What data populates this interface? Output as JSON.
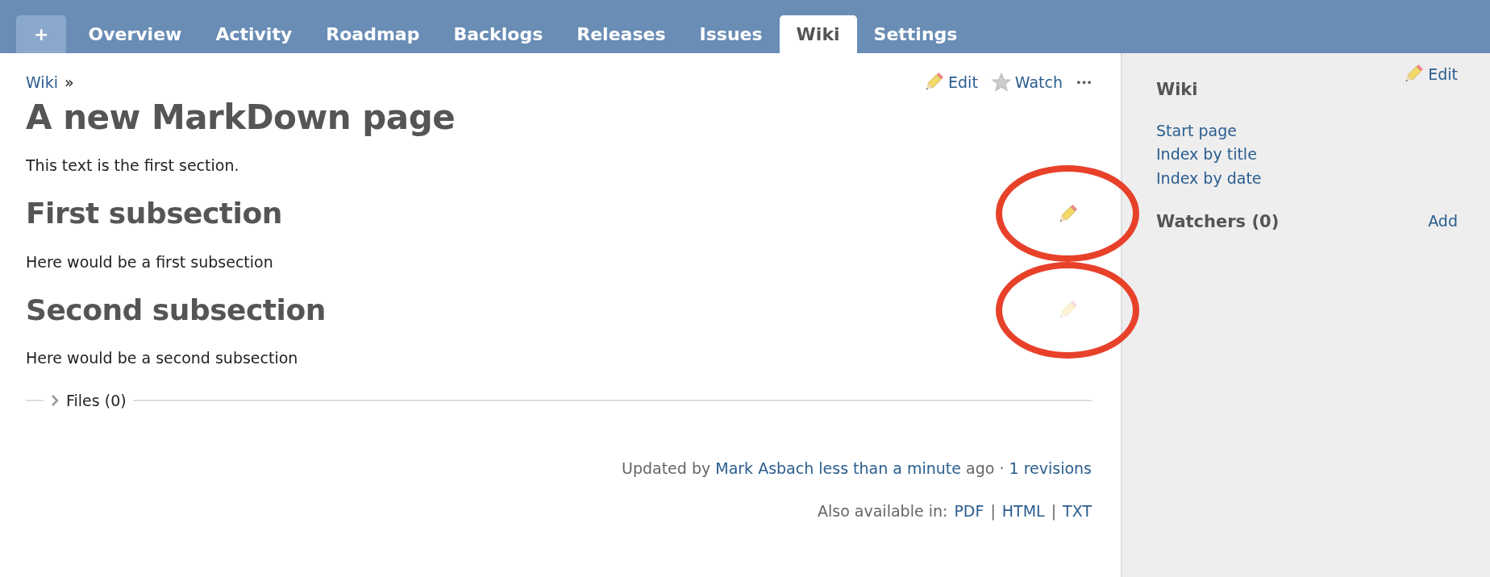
{
  "tabs": [
    {
      "label": "+",
      "kind": "new",
      "selected": false
    },
    {
      "label": "Overview",
      "kind": "tab",
      "selected": false
    },
    {
      "label": "Activity",
      "kind": "tab",
      "selected": false
    },
    {
      "label": "Roadmap",
      "kind": "tab",
      "selected": false
    },
    {
      "label": "Backlogs",
      "kind": "tab",
      "selected": false
    },
    {
      "label": "Releases",
      "kind": "tab",
      "selected": false
    },
    {
      "label": "Issues",
      "kind": "tab",
      "selected": false
    },
    {
      "label": "Wiki",
      "kind": "tab",
      "selected": true
    },
    {
      "label": "Settings",
      "kind": "tab",
      "selected": false
    }
  ],
  "breadcrumb": {
    "link": "Wiki",
    "separator": "»"
  },
  "actions": [
    {
      "label": "Edit",
      "kind": "edit"
    },
    {
      "label": "Watch",
      "kind": "watch"
    },
    {
      "label": "•••",
      "kind": "more"
    }
  ],
  "title": "A new MarkDown page",
  "intro": "This text is the first section.",
  "sections": [
    {
      "heading": "First subsection",
      "text": "Here would be a first subsection",
      "edit_highlighted": true,
      "circled": true
    },
    {
      "heading": "Second subsection",
      "text": "Here would be a second subsection",
      "edit_highlighted": false,
      "circled": true
    }
  ],
  "files": {
    "label": "Files (0)",
    "expanded": false
  },
  "updated": {
    "prefix": "Updated by",
    "author": "Mark Asbach",
    "time": "less than a minute",
    "suffix": "ago ·",
    "revisions": "1 revisions"
  },
  "formats": {
    "label": "Also available in:",
    "links": [
      "PDF",
      "HTML",
      "TXT"
    ],
    "separator": "|"
  },
  "sidebar": {
    "edit": "Edit",
    "heading": "Wiki",
    "links": [
      "Start page",
      "Index by title",
      "Index by date"
    ],
    "watchers": "Watchers (0)",
    "add": "Add"
  }
}
